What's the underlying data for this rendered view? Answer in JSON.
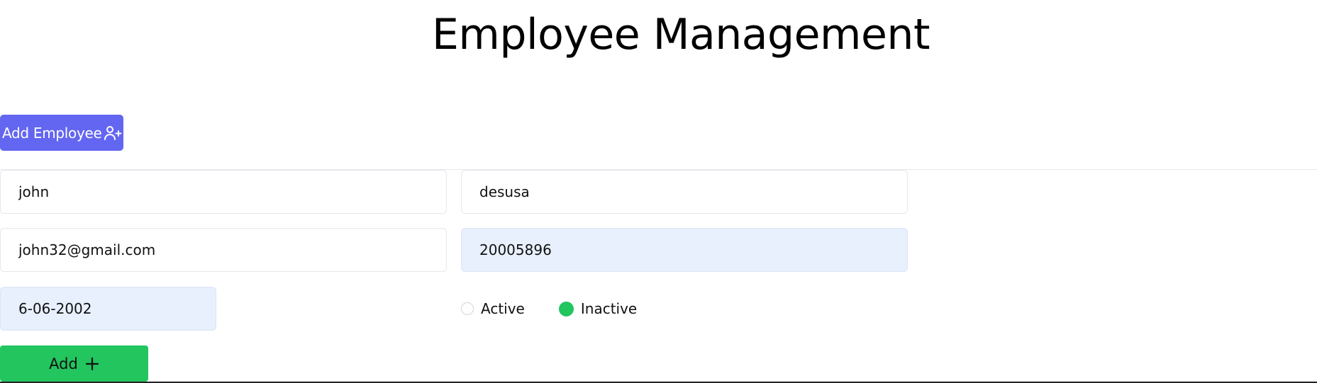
{
  "header": {
    "title": "Employee Management"
  },
  "toolbar": {
    "add_employee_label": "Add Employee",
    "add_employee_icon": "user-plus-icon"
  },
  "form": {
    "first_name": {
      "value": "john"
    },
    "last_name": {
      "value": "desusa"
    },
    "email": {
      "value": "john32@gmail.com"
    },
    "phone": {
      "value": "20005896"
    },
    "dob": {
      "value": "6-06-2002"
    },
    "status": {
      "options": [
        {
          "label": "Active",
          "checked": false
        },
        {
          "label": "Inactive",
          "checked": true
        }
      ]
    },
    "submit_label": "Add",
    "submit_icon": "plus-icon"
  },
  "colors": {
    "primary": "#6366f1",
    "success": "#22c55e",
    "autofill_bg": "#e8f0fe"
  }
}
